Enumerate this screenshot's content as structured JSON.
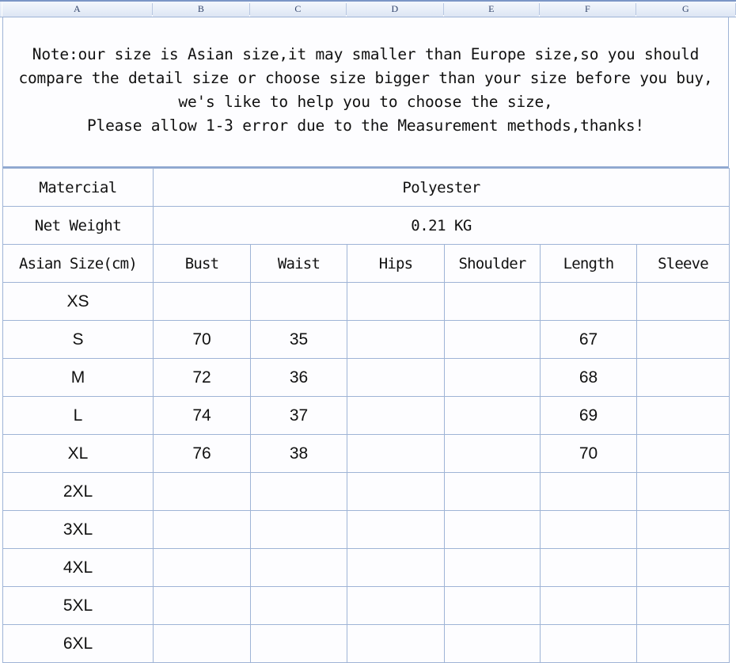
{
  "spreadsheet": {
    "column_headers": [
      "A",
      "B",
      "C",
      "D",
      "E",
      "F",
      "G"
    ]
  },
  "note": {
    "lines": [
      "Note:our size is Asian size,it may smaller than Europe size,so you should",
      "compare the detail size or choose size bigger than your size before you buy,",
      "we's like to help you to choose the size,",
      "Please allow 1-3 error due to the Measurement methods,thanks!"
    ]
  },
  "info_rows": [
    {
      "label": "Matercial",
      "value": "Polyester"
    },
    {
      "label": "Net Weight",
      "value": "0.21 KG"
    }
  ],
  "chart_data": {
    "type": "table",
    "title": "Asian Size Chart (cm)",
    "columns": [
      "Asian Size(cm)",
      "Bust",
      "Waist",
      "Hips",
      "Shoulder",
      "Length",
      "Sleeve"
    ],
    "rows": [
      {
        "size": "XS",
        "bust": "",
        "waist": "",
        "hips": "",
        "shoulder": "",
        "length": "",
        "sleeve": ""
      },
      {
        "size": "S",
        "bust": "70",
        "waist": "35",
        "hips": "",
        "shoulder": "",
        "length": "67",
        "sleeve": ""
      },
      {
        "size": "M",
        "bust": "72",
        "waist": "36",
        "hips": "",
        "shoulder": "",
        "length": "68",
        "sleeve": ""
      },
      {
        "size": "L",
        "bust": "74",
        "waist": "37",
        "hips": "",
        "shoulder": "",
        "length": "69",
        "sleeve": ""
      },
      {
        "size": "XL",
        "bust": "76",
        "waist": "38",
        "hips": "",
        "shoulder": "",
        "length": "70",
        "sleeve": ""
      },
      {
        "size": "2XL",
        "bust": "",
        "waist": "",
        "hips": "",
        "shoulder": "",
        "length": "",
        "sleeve": ""
      },
      {
        "size": "3XL",
        "bust": "",
        "waist": "",
        "hips": "",
        "shoulder": "",
        "length": "",
        "sleeve": ""
      },
      {
        "size": "4XL",
        "bust": "",
        "waist": "",
        "hips": "",
        "shoulder": "",
        "length": "",
        "sleeve": ""
      },
      {
        "size": "5XL",
        "bust": "",
        "waist": "",
        "hips": "",
        "shoulder": "",
        "length": "",
        "sleeve": ""
      },
      {
        "size": "6XL",
        "bust": "",
        "waist": "",
        "hips": "",
        "shoulder": "",
        "length": "",
        "sleeve": ""
      }
    ]
  },
  "colors": {
    "gridline": "#9fb4d6",
    "header_text": "#32446b",
    "cell_text": "#111111"
  }
}
